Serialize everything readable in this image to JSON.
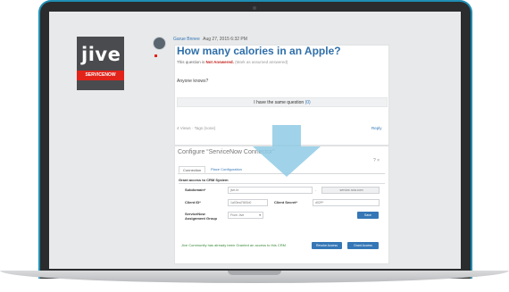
{
  "brand": {
    "logo_text": "jive",
    "logo_band": "SERVICENOW"
  },
  "question": {
    "author": "Garue Bnnee",
    "date": "Aug 27, 2015 6:32 PM",
    "title": "How many calories in an Apple?",
    "status_prefix": "This question is",
    "status_value": "Not Answered.",
    "status_suffix": "(Mark as assumed answered)",
    "body": "Anyone knows?",
    "same_question_label": "I have the same question",
    "same_question_count": "(0)",
    "footer_meta": "4 Views  · Tags (none)",
    "reply_label": "Reply"
  },
  "config": {
    "title": "Configure “ServiceNow Connector”",
    "icons": "? ×",
    "tabs": [
      "Connection",
      "Place Configuration"
    ],
    "section_title": "Grant access to CRM System",
    "subdomain_label": "Subdomain*",
    "subdomain_value": "jive-hr",
    "domain_suffix": "service-now.com",
    "client_id_label": "Client ID*",
    "client_id_value": "1a03ea7f4f1b0",
    "client_secret_label": "Client Secret*",
    "client_secret_value": "d02f**",
    "assignment_group_label": "ServiceNow Assignment Group",
    "assignment_group_value": "From Jive",
    "save_label": "Save",
    "granted_message": "Jive Community has already been Granted an access to this CRM",
    "revoke_label": "Revoke Access",
    "grant_label": "Grant Access"
  },
  "colors": {
    "frame_accent": "#1f8fb5",
    "link": "#3577b6",
    "arrow": "#8fcbe5",
    "brand_red": "#e2231a"
  }
}
